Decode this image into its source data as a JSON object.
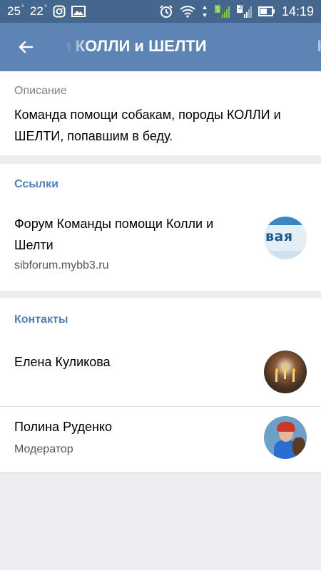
{
  "status_bar": {
    "left_temp_1": "25",
    "left_temp_2": "22",
    "time": "14:19",
    "signal_label": "2"
  },
  "header": {
    "title": "и КОЛЛИ и ШЕЛТИ",
    "edge_text": "К",
    "back_icon": "arrow-left-icon"
  },
  "description": {
    "label": "Описание",
    "text": "Команда помощи собакам, породы КОЛЛИ и ШЕЛТИ, попавшим в беду."
  },
  "links": {
    "title": "Ссылки",
    "items": [
      {
        "title": "Форум Команды помощи Колли и Шелти",
        "url": "sibforum.mybb3.ru",
        "thumb_text": "вая"
      }
    ]
  },
  "contacts": {
    "title": "Контакты",
    "items": [
      {
        "name": "Елена Куликова"
      },
      {
        "name": "Полина Руденко",
        "role": "Модератор"
      }
    ]
  },
  "colors": {
    "status_bar": "#46678d",
    "app_bar": "#5d84b5",
    "section_title": "#5181b8",
    "background": "#ebedf0"
  }
}
